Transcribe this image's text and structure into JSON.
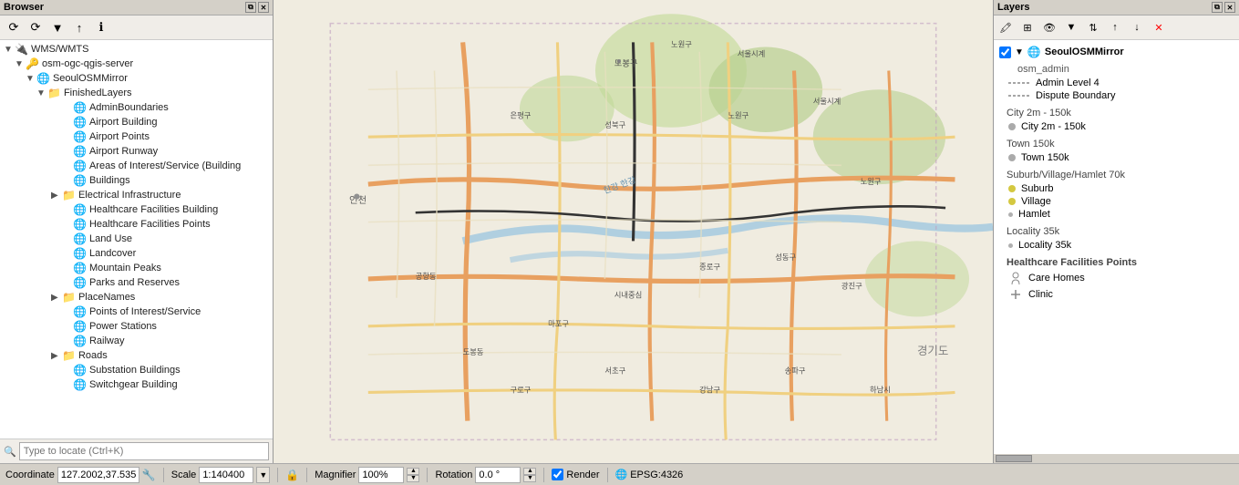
{
  "browser": {
    "title": "Browser",
    "toolbar": {
      "buttons": [
        "⟳",
        "⟳",
        "▼",
        "↑",
        "ℹ"
      ]
    },
    "tree": {
      "items": [
        {
          "id": "wms",
          "label": "WMS/WMTS",
          "level": 0,
          "type": "folder",
          "expanded": true
        },
        {
          "id": "osm-server",
          "label": "osm-ogc-qgis-server",
          "level": 1,
          "type": "server",
          "expanded": true
        },
        {
          "id": "seoulosm",
          "label": "SeoulOSMMirror",
          "level": 2,
          "type": "globe",
          "expanded": true
        },
        {
          "id": "finished",
          "label": "FinishedLayers",
          "level": 3,
          "type": "folder",
          "expanded": true
        },
        {
          "id": "admin",
          "label": "AdminBoundaries",
          "level": 4,
          "type": "globe"
        },
        {
          "id": "airportbuilding",
          "label": "Airport Building",
          "level": 4,
          "type": "globe"
        },
        {
          "id": "airportpoints",
          "label": "Airport Points",
          "level": 4,
          "type": "globe"
        },
        {
          "id": "airportrunway",
          "label": "Airport Runway",
          "level": 4,
          "type": "globe"
        },
        {
          "id": "areasofinterest",
          "label": "Areas of Interest/Service (Building",
          "level": 4,
          "type": "globe"
        },
        {
          "id": "buildings",
          "label": "Buildings",
          "level": 4,
          "type": "globe"
        },
        {
          "id": "electrical",
          "label": "Electrical Infrastructure",
          "level": 4,
          "type": "folder",
          "expanded": false
        },
        {
          "id": "healthcare_b",
          "label": "Healthcare Facilities Building",
          "level": 4,
          "type": "globe"
        },
        {
          "id": "healthcare_p",
          "label": "Healthcare Facilities Points",
          "level": 4,
          "type": "globe"
        },
        {
          "id": "landuse",
          "label": "Land Use",
          "level": 4,
          "type": "globe"
        },
        {
          "id": "landcover",
          "label": "Landcover",
          "level": 4,
          "type": "globe"
        },
        {
          "id": "mtpeaks",
          "label": "Mountain Peaks",
          "level": 4,
          "type": "globe"
        },
        {
          "id": "parks",
          "label": "Parks and Reserves",
          "level": 4,
          "type": "globe"
        },
        {
          "id": "placenames",
          "label": "PlaceNames",
          "level": 4,
          "type": "folder",
          "expanded": false
        },
        {
          "id": "poi",
          "label": "Points of Interest/Service",
          "level": 4,
          "type": "globe"
        },
        {
          "id": "powerstations",
          "label": "Power Stations",
          "level": 4,
          "type": "globe"
        },
        {
          "id": "railway",
          "label": "Railway",
          "level": 4,
          "type": "globe"
        },
        {
          "id": "roads",
          "label": "Roads",
          "level": 4,
          "type": "folder",
          "expanded": false
        },
        {
          "id": "substation",
          "label": "Substation Buildings",
          "level": 4,
          "type": "globe"
        },
        {
          "id": "switchgear",
          "label": "Switchgear Building",
          "level": 4,
          "type": "globe"
        }
      ]
    },
    "search_placeholder": "Type to locate (Ctrl+K)"
  },
  "layers_panel": {
    "title": "Layers",
    "group_name": "SeoulOSMMirror",
    "sections": [
      {
        "id": "osm_admin",
        "title": "osm_admin",
        "entries": [
          {
            "symbol": "dashed",
            "label": "Admin Level 4"
          },
          {
            "symbol": "dashed",
            "label": "Dispute Boundary"
          }
        ]
      },
      {
        "id": "city_2m",
        "title": "City 2m - 150k",
        "entries": [
          {
            "symbol": "dot-gray",
            "label": "City 2m - 150k"
          }
        ]
      },
      {
        "id": "town_150k",
        "title": "Town 150k",
        "entries": [
          {
            "symbol": "dot-gray",
            "label": "Town 150k"
          }
        ]
      },
      {
        "id": "suburb",
        "title": "Suburb/Village/Hamlet 70k",
        "entries": [
          {
            "symbol": "dot-yellow",
            "label": "Suburb"
          },
          {
            "symbol": "dot-yellow",
            "label": "Village"
          },
          {
            "symbol": "dot-small",
            "label": "Hamlet"
          }
        ]
      },
      {
        "id": "locality",
        "title": "Locality 35k",
        "entries": [
          {
            "symbol": "dot-small",
            "label": "Locality 35k"
          }
        ]
      },
      {
        "id": "healthcare",
        "title": "Healthcare Facilities Points",
        "entries": [
          {
            "symbol": "person",
            "label": "Care Homes"
          },
          {
            "symbol": "plus",
            "label": "Clinic"
          }
        ]
      }
    ]
  },
  "status_bar": {
    "coordinate_label": "Coordinate",
    "coordinate_value": "127.2002,37.5352",
    "scale_label": "Scale",
    "scale_value": "1:140400",
    "magnifier_label": "Magnifier",
    "magnifier_value": "100%",
    "rotation_label": "Rotation",
    "rotation_value": "0.0 °",
    "render_label": "Render",
    "epsg_label": "EPSG:4326"
  }
}
